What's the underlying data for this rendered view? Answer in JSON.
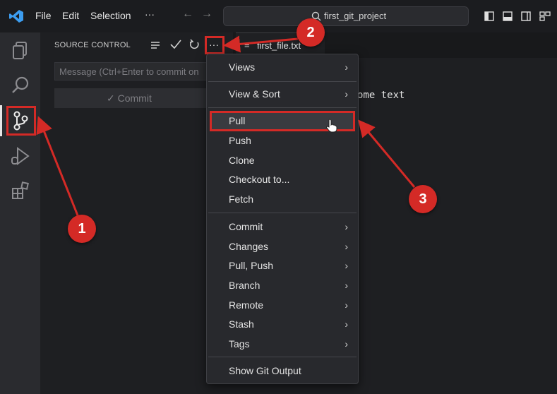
{
  "titlebar": {
    "menus": [
      "File",
      "Edit",
      "Selection"
    ],
    "more": "···",
    "search_text": "first_git_project"
  },
  "sidebar": {
    "header": "SOURCE CONTROL",
    "message_placeholder": "Message (Ctrl+Enter to commit on",
    "commit_label": "✓ Commit",
    "more": "···"
  },
  "editor": {
    "tab_label": "first_file.txt",
    "code_text": "ome text"
  },
  "menu": {
    "items": [
      {
        "label": "Views",
        "chevron": "›"
      },
      {
        "label": "View & Sort",
        "chevron": "›"
      },
      {
        "label": "Pull"
      },
      {
        "label": "Push"
      },
      {
        "label": "Clone"
      },
      {
        "label": "Checkout to..."
      },
      {
        "label": "Fetch"
      },
      {
        "label": "Commit",
        "chevron": "›"
      },
      {
        "label": "Changes",
        "chevron": "›"
      },
      {
        "label": "Pull, Push",
        "chevron": "›"
      },
      {
        "label": "Branch",
        "chevron": "›"
      },
      {
        "label": "Remote",
        "chevron": "›"
      },
      {
        "label": "Stash",
        "chevron": "›"
      },
      {
        "label": "Tags",
        "chevron": "›"
      },
      {
        "label": "Show Git Output"
      }
    ]
  },
  "callouts": [
    "1",
    "2",
    "3"
  ],
  "colors": {
    "accent": "#d42a26",
    "vscode_blue": "#3c9df0"
  }
}
